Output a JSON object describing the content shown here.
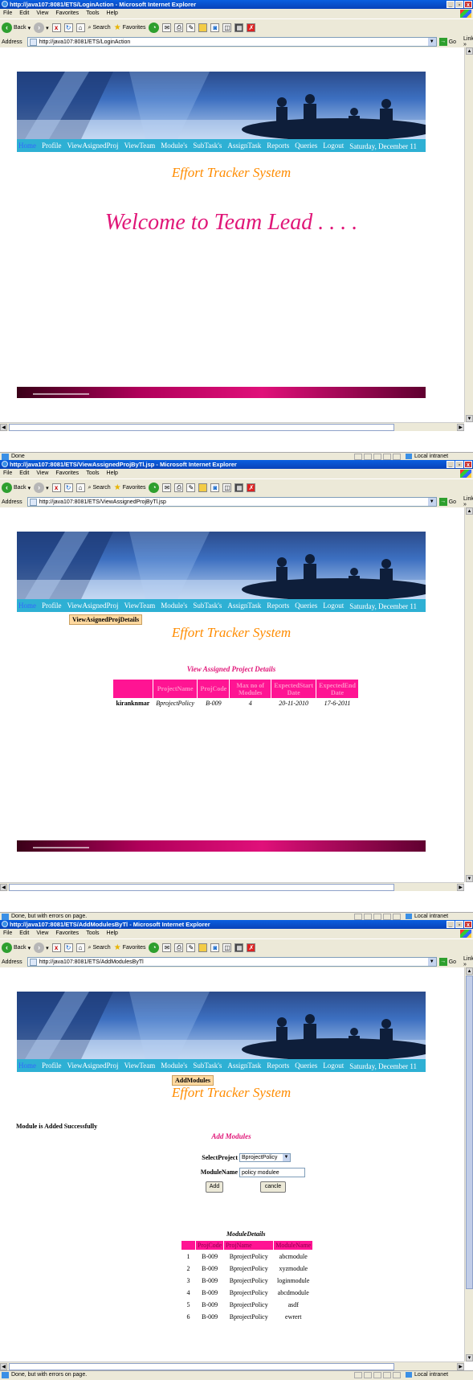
{
  "browser": {
    "menu": [
      "File",
      "Edit",
      "View",
      "Favorites",
      "Tools",
      "Help"
    ],
    "toolbar": {
      "back": "Back",
      "search": "Search",
      "favorites": "Favorites"
    },
    "address_label": "Address",
    "go_label": "Go",
    "links_label": "Links »",
    "zone": "Local intranet"
  },
  "site": {
    "nav": [
      "Home",
      "Profile",
      "ViewAsignedProj",
      "ViewTeam",
      "Module's",
      "SubTask's",
      "AssignTask",
      "Reports",
      "Queries",
      "Logout"
    ],
    "date": "Saturday, December 11",
    "app_title": "Effort Tracker System"
  },
  "windows": [
    {
      "title": "http://java107:8081/ETS/LoginAction - Microsoft Internet Explorer",
      "address": "http://java107:8081/ETS/LoginAction",
      "status": "Done",
      "welcome": "Welcome to Team  Lead . . . ."
    },
    {
      "title": "http://java107:8081/ETS/ViewAssignedProjByTl.jsp - Microsoft Internet Explorer",
      "address": "http://java107:8081/ETS/ViewAssignedProjByTl.jsp",
      "status": "Done, but with errors on page.",
      "dropdown": "ViewAsignedProjDetails",
      "section_title": "View Assigned Project Details",
      "table": {
        "headers": [
          "",
          "ProjectName",
          "ProjCode",
          "Max no of Modules",
          "ExpectedStart Date",
          "ExpectedEnd Date"
        ],
        "rows": [
          [
            "kiranknmar",
            "BprojectPolicy",
            "B-009",
            "4",
            "20-11-2010",
            "17-6-2011"
          ]
        ]
      }
    },
    {
      "title": "http://java107:8081/ETS/AddModulesByTl - Microsoft Internet Explorer",
      "address": "http://java107:8081/ETS/AddModulesByTl",
      "status": "Done, but with errors on page.",
      "dropdown": "AddModules",
      "success": "Module is Added Successfully",
      "section_title": "Add Modules",
      "form": {
        "project_label": "SelectProject",
        "project_value": "BprojectPolicy",
        "module_label": "ModuleName",
        "module_value": "policy modulee",
        "add_label": "Add",
        "cancel_label": "cancle"
      },
      "module_details_title": "ModuleDetails",
      "table": {
        "headers": [
          "",
          "ProjCode",
          "ProjName",
          "ModuleName"
        ],
        "rows": [
          [
            "1",
            "B-009",
            "BprojectPolicy",
            "abcmodule"
          ],
          [
            "2",
            "B-009",
            "BprojectPolicy",
            "xyzmodule"
          ],
          [
            "3",
            "B-009",
            "BprojectPolicy",
            "loginmodule"
          ],
          [
            "4",
            "B-009",
            "BprojectPolicy",
            "abcdmodule"
          ],
          [
            "5",
            "B-009",
            "BprojectPolicy",
            "asdf"
          ],
          [
            "6",
            "B-009",
            "BprojectPolicy",
            "ewrert"
          ]
        ]
      }
    }
  ]
}
